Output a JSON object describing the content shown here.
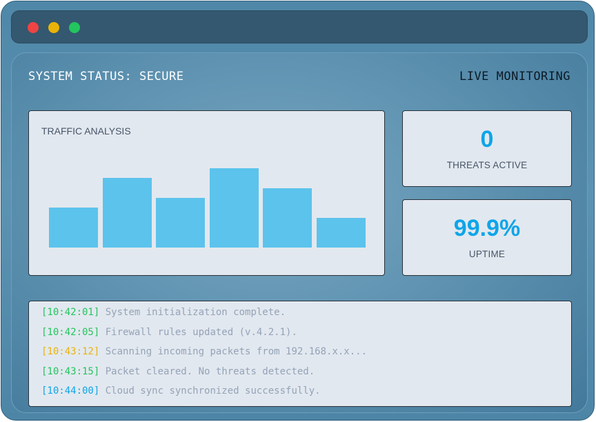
{
  "window": {
    "controls": [
      {
        "name": "close",
        "color": "#ef4444"
      },
      {
        "name": "minimize",
        "color": "#eab308"
      },
      {
        "name": "maximize",
        "color": "#22c55e"
      }
    ]
  },
  "header": {
    "status": "SYSTEM STATUS: SECURE",
    "mode": "LIVE MONITORING"
  },
  "traffic": {
    "title": "TRAFFIC ANALYSIS",
    "bar_levels": [
      0.48,
      0.84,
      0.6,
      0.96,
      0.72,
      0.36
    ],
    "bar_color": "#5cc3ec"
  },
  "threats": {
    "value": "0",
    "label": "THREATS ACTIVE"
  },
  "uptime": {
    "value": "99.9%",
    "label": "UPTIME"
  },
  "log": [
    {
      "time": "[10:42:01]",
      "message": "System initialization complete.",
      "color": "#22c55e"
    },
    {
      "time": "[10:42:05]",
      "message": "Firewall rules updated (v.4.2.1).",
      "color": "#22c55e"
    },
    {
      "time": "[10:43:12]",
      "message": "Scanning incoming packets from 192.168.x.x...",
      "color": "#eab308"
    },
    {
      "time": "[10:43:15]",
      "message": "Packet cleared. No threats detected.",
      "color": "#22c55e"
    },
    {
      "time": "[10:44:00]",
      "message": "Cloud sync synchronized successfully.",
      "color": "#0ea5e9"
    }
  ]
}
